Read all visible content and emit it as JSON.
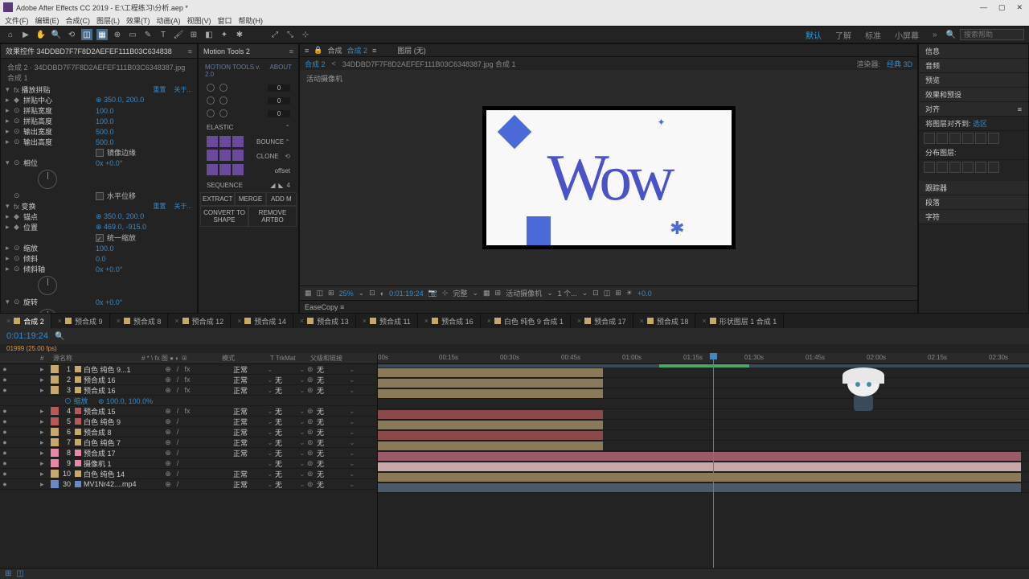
{
  "title": "Adobe After Effects CC 2019 - E:\\工程练习\\分析.aep *",
  "menu": [
    "文件(F)",
    "编辑(E)",
    "合成(C)",
    "图层(L)",
    "效果(T)",
    "动画(A)",
    "视图(V)",
    "窗口",
    "帮助(H)"
  ],
  "workspace": {
    "active": "默认",
    "items": [
      "了解",
      "标准",
      "小屏幕"
    ],
    "search": "搜索帮助"
  },
  "effects": {
    "tab": "效果控件 34DDBD7F7F8D2AEFEF111B03C634838",
    "crumb": "合成 2 · 34DDBD7F7F8D2AEFEF111B03C6348387.jpg 合成 1",
    "reset": "重置",
    "about": "关于...",
    "sect1": "播放拼贴",
    "props1": [
      {
        "n": "拼贴中心",
        "v": "350.0, 200.0",
        "kf": true
      },
      {
        "n": "拼贴宽度",
        "v": "100.0"
      },
      {
        "n": "拼贴高度",
        "v": "100.0"
      },
      {
        "n": "输出宽度",
        "v": "500.0"
      },
      {
        "n": "输出高度",
        "v": "500.0"
      }
    ],
    "chk1": "镜像边缘",
    "phase": {
      "n": "相位",
      "v": "0x +0.0°"
    },
    "chk2": "水平位移",
    "sect2": "变换",
    "props2": [
      {
        "n": "锚点",
        "v": "350.0, 200.0",
        "kf": true
      },
      {
        "n": "位置",
        "v": "469.0, -915.0",
        "kf": true
      }
    ],
    "chk3": "统一缩放",
    "props3": [
      {
        "n": "缩放",
        "v": "100.0"
      },
      {
        "n": "倾斜",
        "v": "0.0"
      },
      {
        "n": "倾斜轴",
        "v": "0x +0.0°"
      }
    ],
    "rotate": {
      "n": "旋转",
      "v": "0x +0.0°"
    }
  },
  "motionTools": {
    "tab": "Motion Tools 2",
    "brand": "MOTION TOOLS v. 2.0",
    "about": "ABOUT",
    "vals": [
      "0",
      "0",
      "0"
    ],
    "labels": [
      "ELASTIC",
      "BOUNCE",
      "CLONE"
    ],
    "offset": "offset",
    "seq": "SEQUENCE",
    "seqVal": "4",
    "btns1": [
      "EXTRACT",
      "MERGE",
      "ADD M"
    ],
    "btns2": [
      "CONVERT TO SHAPE",
      "REMOVE ARTBO"
    ]
  },
  "viewer": {
    "tabLabel": "合成",
    "tabName": "合成 2",
    "layerLabel": "图层 (无)",
    "crumbA": "合成 2",
    "crumbB": "34DDBD7F7F8D2AEFEF111B03C6348387.jpg 合成 1",
    "renderer": "渲染器:",
    "rendererV": "经典 3D",
    "camLabel": "活动摄像机",
    "wow": "Wow",
    "zoom": "25%",
    "tc": "0:01:19:24",
    "res": "完整",
    "cam": "活动摄像机",
    "views": "1 个...",
    "exp": "+0.0",
    "easecopy": "EaseCopy"
  },
  "right": {
    "items": [
      "信息",
      "音频",
      "预览",
      "效果和预设"
    ],
    "align": "对齐",
    "alignTo": "将图层对齐到:",
    "alignV": "选区",
    "dist": "分布图层:",
    "tracker": "跟踪器",
    "para": "段落",
    "char": "字符"
  },
  "timeline": {
    "tabs": [
      "合成 2",
      "预合成 9",
      "预合成 8",
      "预合成 12",
      "预合成 14",
      "预合成 13",
      "预合成 11",
      "预合成 16",
      "白色 纯色 9 合成 1",
      "预合成 17",
      "预合成 18",
      "形状图层 1 合成 1"
    ],
    "time": "0:01:19:24",
    "fps": "01999 (25.00 fps)",
    "cols": {
      "num": "#",
      "src": "源名称",
      "flags": "# * \\ fx 图 ● ◐ ⊕",
      "mode": "模式",
      "trk": "T TrkMat",
      "parent": "父级和链接"
    },
    "modeNormal": "正常",
    "none": "无",
    "scale": "缩放",
    "scaleV": "100.0, 100.0%",
    "layers": [
      {
        "i": "1",
        "c": "#c8a868",
        "n": "白色 纯色 9...1",
        "fx": true
      },
      {
        "i": "2",
        "c": "#c8a868",
        "n": "预合成 16",
        "fx": true
      },
      {
        "i": "3",
        "c": "#c8a868",
        "n": "预合成 16",
        "fx": true,
        "open": true
      },
      {
        "i": "4",
        "c": "#b85858",
        "n": "预合成 15",
        "fx": true
      },
      {
        "i": "5",
        "c": "#b85858",
        "n": "白色 纯色 9"
      },
      {
        "i": "6",
        "c": "#c8a868",
        "n": "预合成 8"
      },
      {
        "i": "7",
        "c": "#c8a868",
        "n": "白色 纯色 7"
      },
      {
        "i": "8",
        "c": "#e888a8",
        "n": "预合成 17"
      },
      {
        "i": "9",
        "c": "#e888a8",
        "n": "摄像机 1"
      },
      {
        "i": "10",
        "c": "#c8a868",
        "n": "白色 纯色 14"
      },
      {
        "i": "30",
        "c": "#6888c8",
        "n": "MV1Nr42....mp4"
      }
    ],
    "ruler": [
      "00s",
      "00:15s",
      "00:30s",
      "00:45s",
      "01:00s",
      "01:15s",
      "01:30s",
      "01:45s",
      "02:00s",
      "02:15s",
      "02:30s"
    ]
  }
}
